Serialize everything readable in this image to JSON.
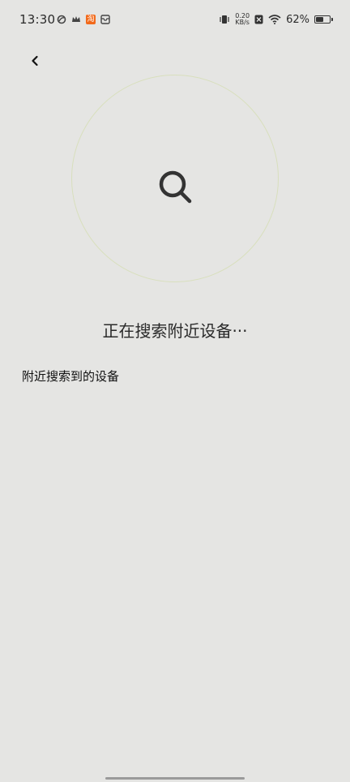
{
  "status_bar": {
    "time": "13:30",
    "taobao_glyph": "淘",
    "net_speed_value": "0.20",
    "net_speed_unit": "KB/s",
    "battery_percent": "62%",
    "battery_level": 0.62,
    "icons_left": [
      "app-swirl-icon",
      "crown-icon",
      "taobao-icon",
      "inbox-icon"
    ],
    "icons_right": [
      "vibrate-icon",
      "sim-off-icon",
      "wifi-icon",
      "battery-icon"
    ]
  },
  "nav": {
    "back_icon": "chevron-left-icon"
  },
  "search": {
    "status_text": "正在搜索附近设备···",
    "icon": "search-icon",
    "ring_color": "#d8dfbd"
  },
  "devices": {
    "section_title": "附近搜索到的设备",
    "items": []
  }
}
